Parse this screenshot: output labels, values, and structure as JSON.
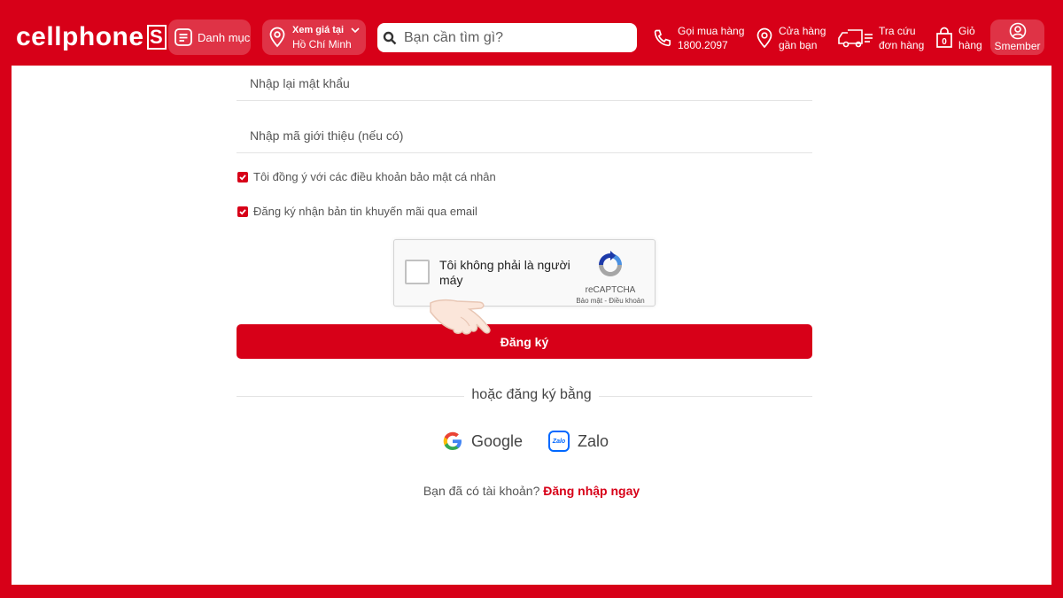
{
  "header": {
    "logo_text": "cellphone",
    "logo_s": "S",
    "menu_label": "Danh mục",
    "location_small": "Xem giá tại",
    "location_city": "Hồ Chí Minh",
    "search_placeholder": "Bạn cần tìm gì?",
    "hotline_label": "Gọi mua hàng",
    "hotline_number": "1800.2097",
    "store_line1": "Cửa hàng",
    "store_line2": "gần bạn",
    "order_line1": "Tra cứu",
    "order_line2": "đơn hàng",
    "cart_line1": "Giỏ",
    "cart_line2": "hàng",
    "cart_count": "0",
    "member_label": "Smember"
  },
  "form": {
    "confirm_password_placeholder": "Nhập lại mật khẩu",
    "referral_placeholder": "Nhập mã giới thiệu (nếu có)",
    "agree_terms": "Tôi đồng ý với các điều khoản bảo mật cá nhân",
    "newsletter": "Đăng ký nhận bản tin khuyến mãi qua email",
    "captcha_label": "Tôi không phải là người máy",
    "captcha_brand": "reCAPTCHA",
    "captcha_links": "Bảo mật - Điều khoản",
    "submit_label": "Đăng ký",
    "or_text": "hoặc đăng ký bằng",
    "google_label": "Google",
    "zalo_label": "Zalo",
    "zalo_icon_text": "Zalo",
    "have_account": "Bạn đã có tài khoản?",
    "login_link": "Đăng nhập ngay"
  },
  "colors": {
    "brand": "#d70018"
  }
}
